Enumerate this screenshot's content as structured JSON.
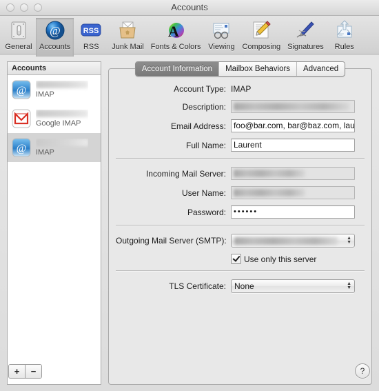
{
  "window": {
    "title": "Accounts",
    "traffic_lights": [
      "close",
      "minimize",
      "zoom"
    ]
  },
  "toolbar": {
    "items": [
      {
        "label": "General",
        "icon": "lightswitch-icon",
        "selected": false
      },
      {
        "label": "Accounts",
        "icon": "at-sign-icon",
        "selected": true
      },
      {
        "label": "RSS",
        "icon": "rss-icon",
        "selected": false
      },
      {
        "label": "Junk Mail",
        "icon": "junk-bin-icon",
        "selected": false
      },
      {
        "label": "Fonts & Colors",
        "icon": "color-wheel-a-icon",
        "selected": false
      },
      {
        "label": "Viewing",
        "icon": "glasses-icon",
        "selected": false
      },
      {
        "label": "Composing",
        "icon": "pencil-paper-icon",
        "selected": false
      },
      {
        "label": "Signatures",
        "icon": "fountain-pen-icon",
        "selected": false
      },
      {
        "label": "Rules",
        "icon": "rules-arrows-icon",
        "selected": false
      }
    ]
  },
  "sidebar": {
    "header": "Accounts",
    "accounts": [
      {
        "name": "",
        "type": "IMAP",
        "icon": "mail-at-icon",
        "selected": false,
        "name_redacted": true
      },
      {
        "name": "",
        "type": "Google IMAP",
        "icon": "gmail-icon",
        "selected": false,
        "name_redacted": true
      },
      {
        "name": "",
        "type": "IMAP",
        "icon": "mail-at-icon",
        "selected": true,
        "name_redacted": true
      }
    ]
  },
  "tabs": [
    {
      "label": "Account Information",
      "active": true
    },
    {
      "label": "Mailbox Behaviors",
      "active": false
    },
    {
      "label": "Advanced",
      "active": false
    }
  ],
  "form": {
    "account_type": {
      "label": "Account Type:",
      "value": "IMAP"
    },
    "description": {
      "label": "Description:",
      "value": "",
      "redacted": true,
      "disabled": true
    },
    "email_address": {
      "label": "Email Address:",
      "value": "foo@bar.com, bar@baz.com, lau"
    },
    "full_name": {
      "label": "Full Name:",
      "value": "Laurent"
    },
    "incoming_mail_server": {
      "label": "Incoming Mail Server:",
      "value": "",
      "redacted": true,
      "disabled": true
    },
    "user_name": {
      "label": "User Name:",
      "value": "",
      "redacted": true,
      "disabled": true
    },
    "password": {
      "label": "Password:",
      "value": "••••••"
    },
    "outgoing_mail_server": {
      "label": "Outgoing Mail Server (SMTP):",
      "value": "",
      "redacted": true
    },
    "use_only_this_server": {
      "label": "Use only this server",
      "checked": true
    },
    "tls_certificate": {
      "label": "TLS Certificate:",
      "value": "None"
    }
  },
  "footer": {
    "add_label": "+",
    "remove_label": "−",
    "help_label": "?"
  },
  "colors": {
    "window_bg": "#e9e9e9",
    "panel_bg": "#e8e8e8",
    "selected_tab_bg": "#7a7a7a",
    "selection_row_bg": "#d4d4d4",
    "rss_blue": "#3a64cf",
    "gmail_red": "#d93025"
  }
}
